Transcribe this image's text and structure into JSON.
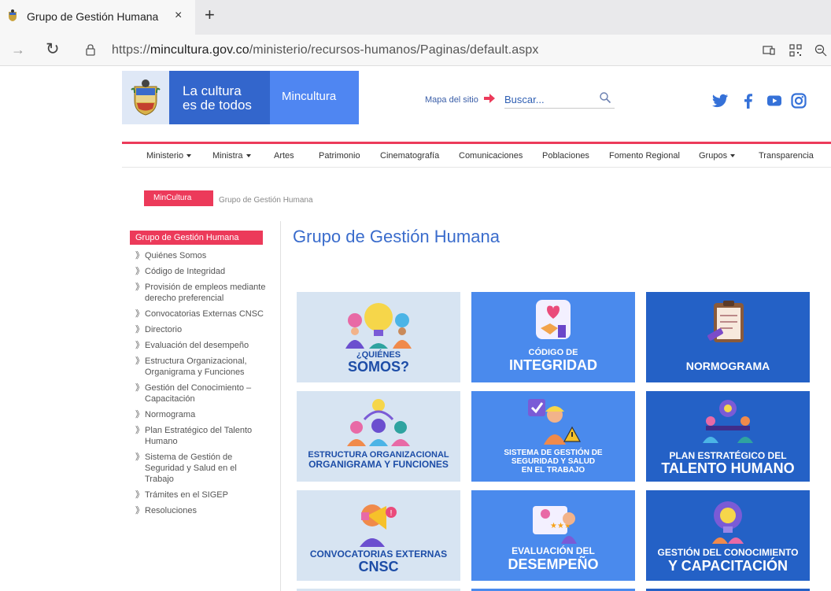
{
  "browser": {
    "tab_title": "Grupo de Gestión Humana",
    "tab_close": "×",
    "new_tab": "+",
    "url_prefix": "https://",
    "url_host": "mincultura.gov.co",
    "url_path": "/ministerio/recursos-humanos/Paginas/default.aspx"
  },
  "header": {
    "logo_line1": "La cultura",
    "logo_line2": "es de todos",
    "logo_brand": "Mincultura",
    "sitemap": "Mapa del sitio",
    "search_placeholder": "Buscar...",
    "social": [
      "twitter-icon",
      "facebook-icon",
      "youtube-icon",
      "instagram-icon"
    ],
    "accent_color": "#ec3a5a",
    "brand_blue": "#3366cc"
  },
  "nav": {
    "items": [
      {
        "label": "Ministerio",
        "dropdown": true
      },
      {
        "label": "Ministra",
        "dropdown": true
      },
      {
        "label": "Artes",
        "dropdown": false
      },
      {
        "label": "Patrimonio",
        "dropdown": false
      },
      {
        "label": "Cinematografía",
        "dropdown": false
      },
      {
        "label": "Comunicaciones",
        "dropdown": false
      },
      {
        "label": "Poblaciones",
        "dropdown": false
      },
      {
        "label": "Fomento Regional",
        "dropdown": false
      },
      {
        "label": "Grupos",
        "dropdown": true
      },
      {
        "label": "Transparencia",
        "dropdown": false
      }
    ]
  },
  "breadcrumb": {
    "home": "MinCultura",
    "current": "Grupo de Gestión Humana"
  },
  "sidebar": {
    "heading": "Grupo de Gestión Humana",
    "bullet": "》",
    "items": [
      {
        "label": "Quiénes Somos"
      },
      {
        "label": "Código de Integridad"
      },
      {
        "label": "Provisión de empleos mediante derecho preferencial"
      },
      {
        "label": "Convocatorias Externas CNSC"
      },
      {
        "label": "Directorio"
      },
      {
        "label": "Evaluación del desempeño"
      },
      {
        "label": "Estructura Organizacional, Organigrama y Funciones"
      },
      {
        "label": "Gestión del Conocimiento – Capacitación"
      },
      {
        "label": "Normograma"
      },
      {
        "label": "Plan Estratégico del Talento Humano"
      },
      {
        "label": "Sistema de Gestión de Seguridad y Salud en el Trabajo"
      },
      {
        "label": "Trámites en el SIGEP"
      },
      {
        "label": "Resoluciones"
      }
    ]
  },
  "main": {
    "title": "Grupo de Gestión Humana",
    "tiles": [
      {
        "line1": "¿QUIÉNES",
        "line2": "SOMOS?"
      },
      {
        "line1": "CÓDIGO DE",
        "line2": "INTEGRIDAD"
      },
      {
        "line1": "",
        "line2": "NORMOGRAMA"
      },
      {
        "line1": "ESTRUCTURA ORGANIZACIONAL",
        "line2": "ORGANIGRAMA Y FUNCIONES"
      },
      {
        "line1": "SISTEMA DE GESTIÓN DE",
        "line2": "SEGURIDAD Y SALUD",
        "line3": "EN EL TRABAJO"
      },
      {
        "line1": "PLAN ESTRATÉGICO DEL",
        "line2": "TALENTO HUMANO"
      },
      {
        "line1": "CONVOCATORIAS EXTERNAS",
        "line2": "CNSC"
      },
      {
        "line1": "EVALUACIÓN DEL",
        "line2": "DESEMPEÑO"
      },
      {
        "line1": "GESTIÓN DEL CONOCIMIENTO",
        "line2": "Y CAPACITACIÓN"
      }
    ]
  }
}
